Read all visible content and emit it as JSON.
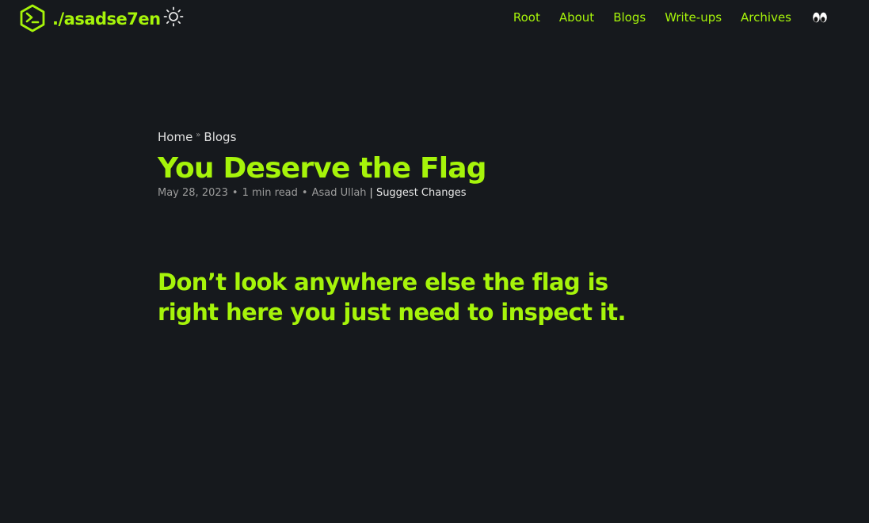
{
  "header": {
    "logo_icon": "terminal-hexagon-icon",
    "site_title": "./asadse7en",
    "theme_icon": "sun-icon",
    "nav": [
      {
        "label": "Root"
      },
      {
        "label": "About"
      },
      {
        "label": "Blogs"
      },
      {
        "label": "Write-ups"
      },
      {
        "label": "Archives"
      }
    ],
    "extra_icon": "eyes-icon"
  },
  "breadcrumb": {
    "home": "Home",
    "separator": "»",
    "current": "Blogs"
  },
  "post": {
    "title": "You Deserve the Flag",
    "meta": {
      "date": "May 28, 2023",
      "read_time": "1 min read",
      "author": "Asad Ullah",
      "suggest_changes": "Suggest Changes",
      "dot": "•",
      "bar": "|"
    },
    "content": "Don’t look anywhere else the flag is right here you just need to inspect it."
  },
  "colors": {
    "background": "#16191d",
    "accent": "#a6f40a",
    "text": "#d6d6d6",
    "muted": "#9b9b9b"
  }
}
